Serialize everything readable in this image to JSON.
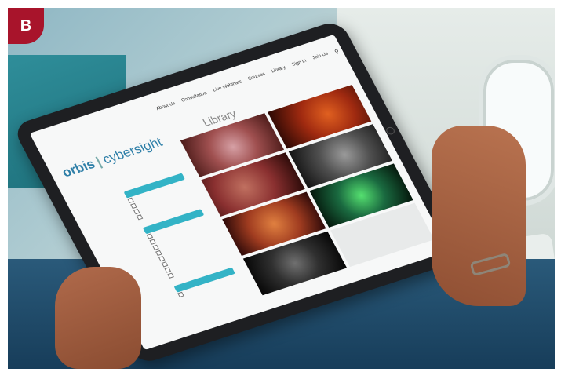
{
  "badge": {
    "letter": "B"
  },
  "app": {
    "logo_brand": "orbis",
    "logo_separator": "|",
    "logo_product": "cybersight"
  },
  "nav": {
    "items": [
      "About Us",
      "Consultation",
      "Live Webinars",
      "Courses",
      "Library",
      "Sign In",
      "Join Us"
    ]
  },
  "page": {
    "title": "Library"
  },
  "colors": {
    "accent": "#33b3c6",
    "badge": "#a8142b",
    "logo": "#2e7fa8"
  }
}
